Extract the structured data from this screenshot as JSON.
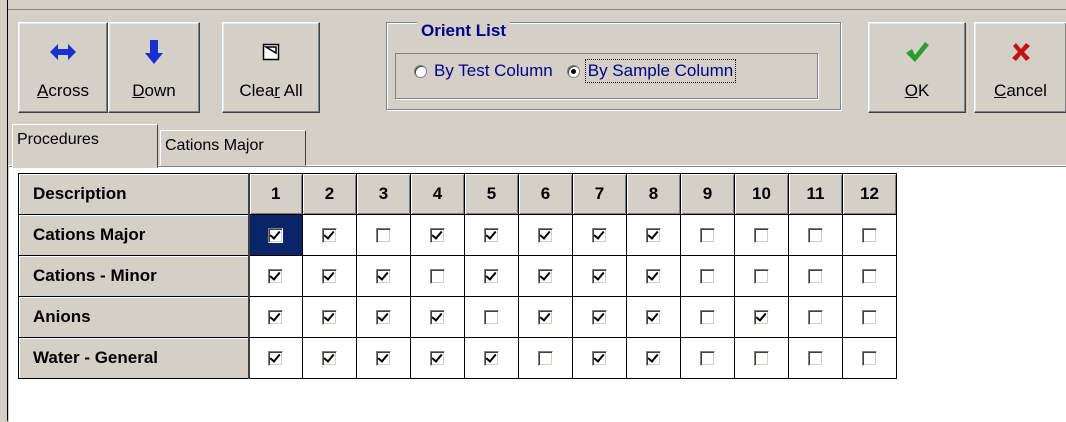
{
  "toolbar": {
    "across": {
      "pre": "",
      "u": "A",
      "post": "cross",
      "icon": "left-right-arrow-icon"
    },
    "down": {
      "pre": "",
      "u": "D",
      "post": "own",
      "icon": "down-arrow-icon"
    },
    "clear_all": {
      "pre": "Clea",
      "u": "r",
      "post": " All",
      "icon": "clear-icon"
    },
    "ok": {
      "pre": "",
      "u": "O",
      "post": "K",
      "icon": "checkmark-icon"
    },
    "cancel": {
      "pre": "",
      "u": "C",
      "post": "ancel",
      "icon": "x-icon"
    }
  },
  "orient": {
    "legend": "Orient List",
    "options": [
      {
        "label": "By Test Column",
        "selected": false
      },
      {
        "label": "By Sample Column",
        "selected": true
      }
    ]
  },
  "tabs": [
    {
      "label": "Procedures",
      "active": true
    },
    {
      "label": "Cations Major",
      "active": false
    }
  ],
  "grid": {
    "header": "Description",
    "columns": [
      "1",
      "2",
      "3",
      "4",
      "5",
      "6",
      "7",
      "8",
      "9",
      "10",
      "11",
      "12"
    ],
    "rows": [
      {
        "label": "Cations Major",
        "checks": [
          true,
          true,
          false,
          true,
          true,
          true,
          true,
          true,
          false,
          false,
          false,
          false
        ]
      },
      {
        "label": "Cations - Minor",
        "checks": [
          true,
          true,
          true,
          false,
          true,
          true,
          true,
          true,
          false,
          false,
          false,
          false
        ]
      },
      {
        "label": "Anions",
        "checks": [
          true,
          true,
          true,
          true,
          false,
          true,
          true,
          true,
          false,
          true,
          false,
          false
        ]
      },
      {
        "label": "Water - General",
        "checks": [
          true,
          true,
          true,
          true,
          true,
          false,
          true,
          true,
          false,
          false,
          false,
          false
        ]
      }
    ],
    "selected_cell": {
      "row": 0,
      "col": 0
    }
  },
  "colors": {
    "accent": "#00008b",
    "selection": "#0a246a",
    "ok_green": "#2e9b2e",
    "cancel_red": "#c81010"
  }
}
